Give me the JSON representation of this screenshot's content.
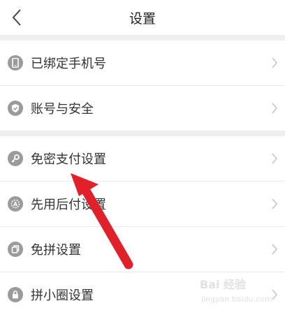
{
  "header": {
    "title": "设置"
  },
  "rows": [
    {
      "label": "已绑定手机号",
      "icon": "phone-icon"
    },
    {
      "label": "账号与安全",
      "icon": "shield-check-icon"
    },
    {
      "label": "免密支付设置",
      "icon": "key-icon"
    },
    {
      "label": "先用后付设置",
      "icon": "badge-a-icon"
    },
    {
      "label": "免拼设置",
      "icon": "copy-icon"
    },
    {
      "label": "拼小圈设置",
      "icon": "lock-icon"
    }
  ],
  "watermark": {
    "text": "Bai 经验",
    "sub": "jingyan.baidu.com"
  },
  "colors": {
    "accent_arrow": "#e2202a",
    "icon_gray": "#9b9b9b",
    "gap": "#efefef"
  }
}
